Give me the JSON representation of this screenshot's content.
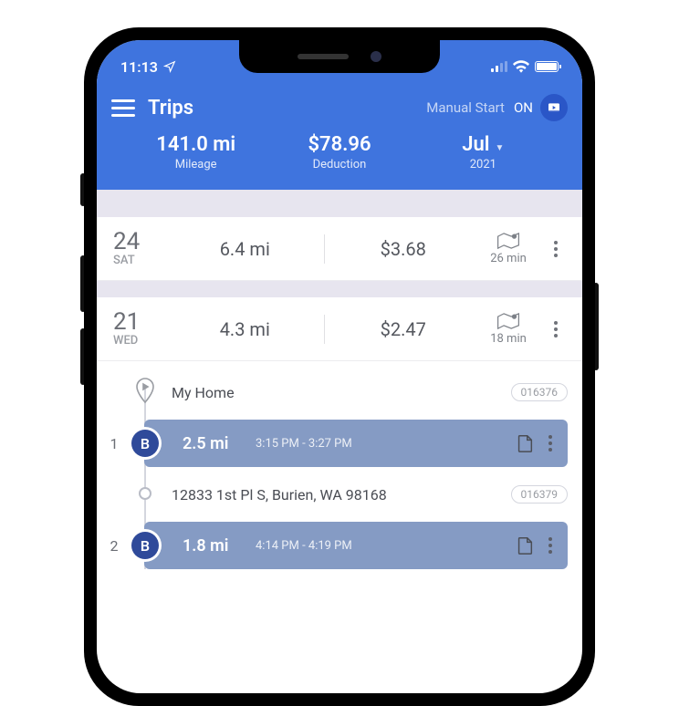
{
  "status": {
    "time": "11:13"
  },
  "header": {
    "title": "Trips",
    "manual_label": "Manual Start",
    "manual_state": "ON"
  },
  "stats": {
    "mileage_val": "141.0 mi",
    "mileage_lbl": "Mileage",
    "deduction_val": "$78.96",
    "deduction_lbl": "Deduction",
    "period_month": "Jul",
    "period_year": "2021"
  },
  "days": [
    {
      "num": "24",
      "dow": "SAT",
      "miles": "6.4 mi",
      "cost": "$3.68",
      "mins": "26 min"
    },
    {
      "num": "21",
      "dow": "WED",
      "miles": "4.3 mi",
      "cost": "$2.47",
      "mins": "18 min"
    }
  ],
  "detail": {
    "start_label": "My Home",
    "start_id": "016376",
    "segments": [
      {
        "idx": "1",
        "badge": "B",
        "miles": "2.5 mi",
        "time": "3:15 PM - 3:27 PM"
      }
    ],
    "wp2_label": "12833 1st Pl S, Burien, WA 98168",
    "wp2_id": "016379",
    "segments2": [
      {
        "idx": "2",
        "badge": "B",
        "miles": "1.8 mi",
        "time": "4:14 PM - 4:19 PM"
      }
    ]
  }
}
